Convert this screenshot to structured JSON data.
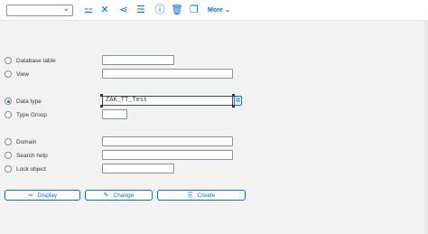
{
  "toolbar": {
    "select_value": "",
    "icons": [
      "hierarchy-icon",
      "where-used-icon",
      "graph-icon",
      "indent-icon",
      "info-icon",
      "delete-icon",
      "copy-icon"
    ],
    "more_label": "More"
  },
  "form": {
    "options": [
      {
        "label": "Database table",
        "value": ""
      },
      {
        "label": "View",
        "value": ""
      },
      {
        "label": "Data type",
        "value": "ZAK_TT_Test",
        "selected": true
      },
      {
        "label": "Type Group",
        "value": ""
      },
      {
        "label": "Domain",
        "value": ""
      },
      {
        "label": "Search help",
        "value": ""
      },
      {
        "label": "Lock object",
        "value": ""
      }
    ]
  },
  "buttons": {
    "display": "Display",
    "change": "Change",
    "create": "Create"
  },
  "colors": {
    "accent": "#0a6ed1",
    "background": "#f2f2f2"
  }
}
